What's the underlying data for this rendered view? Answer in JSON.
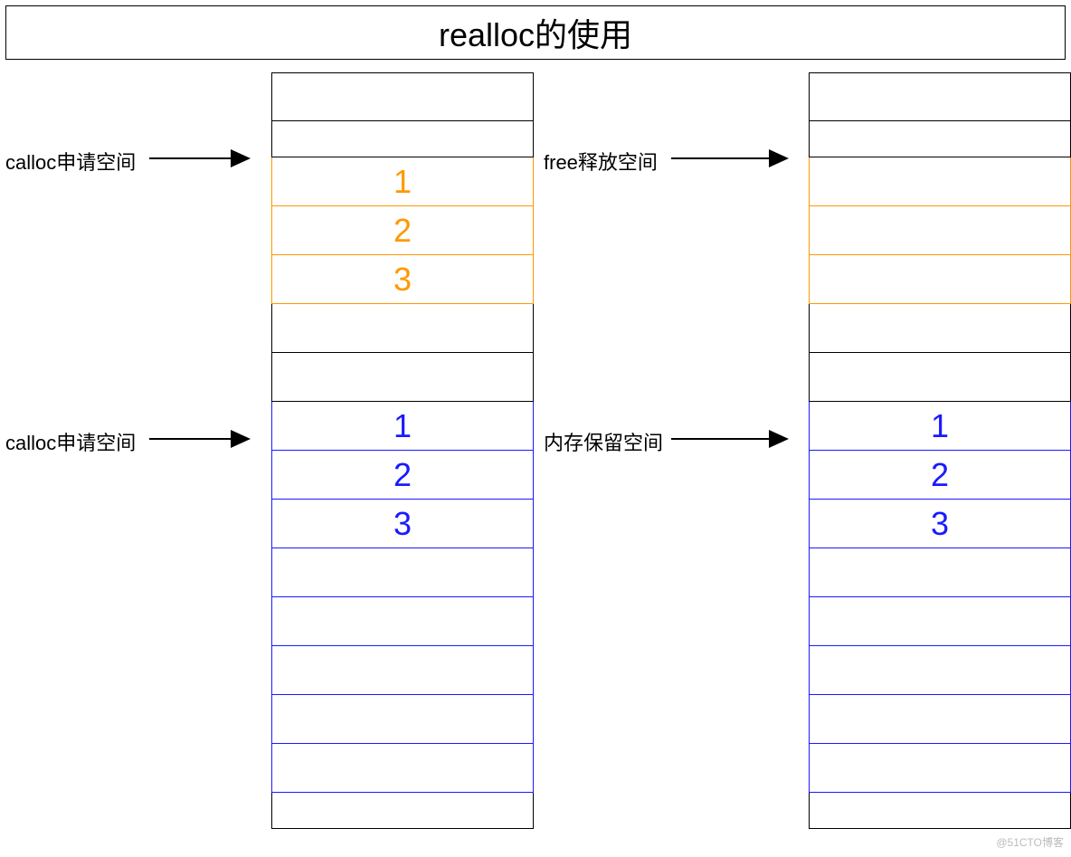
{
  "title": "realloc的使用",
  "labels": {
    "leftTopLabel": "calloc申请空间",
    "leftBottomLabel": "calloc申请空间",
    "rightTopLabel": "free释放空间",
    "rightBottomLabel": "内存保留空间"
  },
  "leftColumn": [
    {
      "text": "",
      "color": "black",
      "first": true
    },
    {
      "text": "",
      "color": "black",
      "short": true
    },
    {
      "text": "1",
      "color": "orange"
    },
    {
      "text": "2",
      "color": "orange"
    },
    {
      "text": "3",
      "color": "orange"
    },
    {
      "text": "",
      "color": "black"
    },
    {
      "text": "",
      "color": "black"
    },
    {
      "text": "1",
      "color": "blue"
    },
    {
      "text": "2",
      "color": "blue"
    },
    {
      "text": "3",
      "color": "blue"
    },
    {
      "text": "",
      "color": "blue"
    },
    {
      "text": "",
      "color": "blue"
    },
    {
      "text": "",
      "color": "blue"
    },
    {
      "text": "",
      "color": "blue"
    },
    {
      "text": "",
      "color": "blue"
    },
    {
      "text": "",
      "color": "black",
      "short": true
    }
  ],
  "rightColumn": [
    {
      "text": "",
      "color": "black",
      "first": true
    },
    {
      "text": "",
      "color": "black",
      "short": true
    },
    {
      "text": "",
      "color": "orange"
    },
    {
      "text": "",
      "color": "orange"
    },
    {
      "text": "",
      "color": "orange"
    },
    {
      "text": "",
      "color": "black"
    },
    {
      "text": "",
      "color": "black"
    },
    {
      "text": "1",
      "color": "blue"
    },
    {
      "text": "2",
      "color": "blue"
    },
    {
      "text": "3",
      "color": "blue"
    },
    {
      "text": "",
      "color": "blue"
    },
    {
      "text": "",
      "color": "blue"
    },
    {
      "text": "",
      "color": "blue"
    },
    {
      "text": "",
      "color": "blue"
    },
    {
      "text": "",
      "color": "blue"
    },
    {
      "text": "",
      "color": "black",
      "short": true
    }
  ],
  "arrows": {
    "leftTop": {
      "labelLeft": 6,
      "labelTop": 162,
      "lineLeft": 165,
      "lineTop": 174,
      "lineWidth": 110
    },
    "leftBottom": {
      "labelLeft": 6,
      "labelTop": 472,
      "lineLeft": 165,
      "lineTop": 484,
      "lineWidth": 110
    },
    "rightTop": {
      "labelLeft": 601,
      "labelTop": 162,
      "lineLeft": 742,
      "lineTop": 174,
      "lineWidth": 128
    },
    "rightBottom": {
      "labelLeft": 601,
      "labelTop": 472,
      "lineLeft": 742,
      "lineTop": 484,
      "lineWidth": 128
    }
  },
  "watermark": "@51CTO博客"
}
